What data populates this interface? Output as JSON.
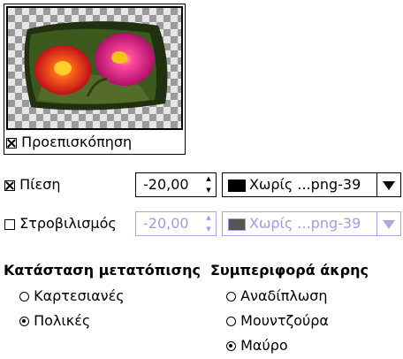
{
  "preview": {
    "checkbox_label": "Προεπισκόπηση",
    "checked": true
  },
  "pressure": {
    "label": "Πίεση",
    "checked": true,
    "value": "-20,00",
    "gradient": "Χωρίς ...png-39",
    "enabled": true
  },
  "swirl": {
    "label": "Στροβιλισμός",
    "checked": false,
    "value": "-20,00",
    "gradient": "Χωρίς ...png-39",
    "enabled": false
  },
  "displacement_mode": {
    "heading": "Κατάσταση μετατόπισης",
    "options": [
      {
        "label": "Καρτεσιανές",
        "selected": false
      },
      {
        "label": "Πολικές",
        "selected": true
      }
    ]
  },
  "edge_behavior": {
    "heading": "Συμπεριφορά άκρης",
    "options": [
      {
        "label": "Αναδίπλωση",
        "selected": false
      },
      {
        "label": "Μουντζούρα",
        "selected": false
      },
      {
        "label": "Μαύρο",
        "selected": true
      }
    ]
  },
  "icons": {
    "spin_up": "triangle-up",
    "spin_down": "triangle-down",
    "dropdown": "triangle-down"
  }
}
